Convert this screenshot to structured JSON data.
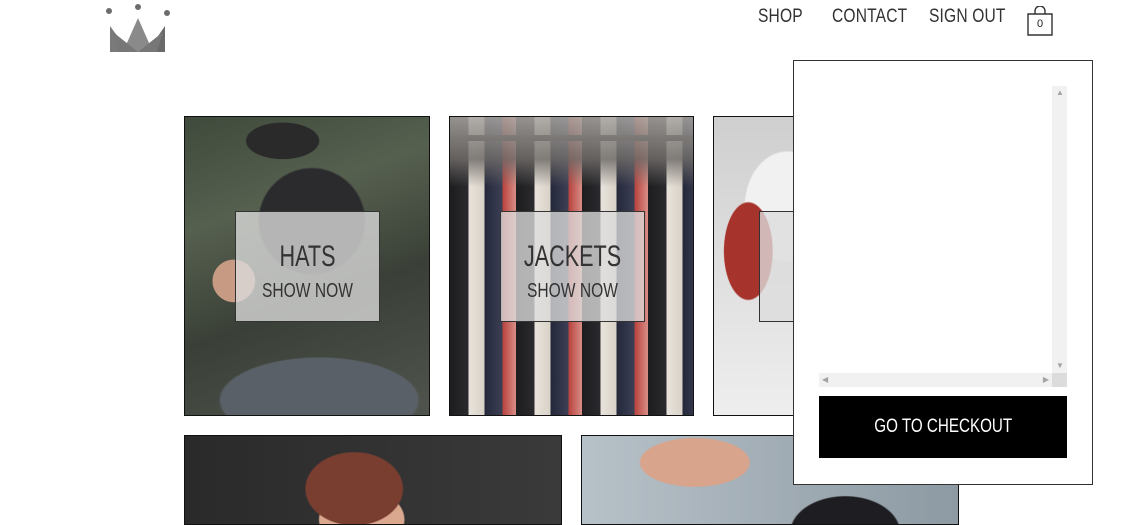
{
  "header": {
    "logo_icon": "crown-icon",
    "nav": [
      {
        "label": "SHOP"
      },
      {
        "label": "CONTACT"
      },
      {
        "label": "SIGN OUT"
      }
    ],
    "cart": {
      "icon": "shopping-bag-icon",
      "count": "0"
    }
  },
  "categories": [
    {
      "title": "HATS",
      "cta": "SHOW NOW"
    },
    {
      "title": "JACKETS",
      "cta": "SHOW NOW"
    },
    {
      "title": "",
      "cta": ""
    }
  ],
  "cart_dropdown": {
    "checkout_label": "GO TO CHECKOUT"
  },
  "colors": {
    "checkout_button": "#000000",
    "overlay": "#dcdcdc",
    "text": "#333333"
  }
}
